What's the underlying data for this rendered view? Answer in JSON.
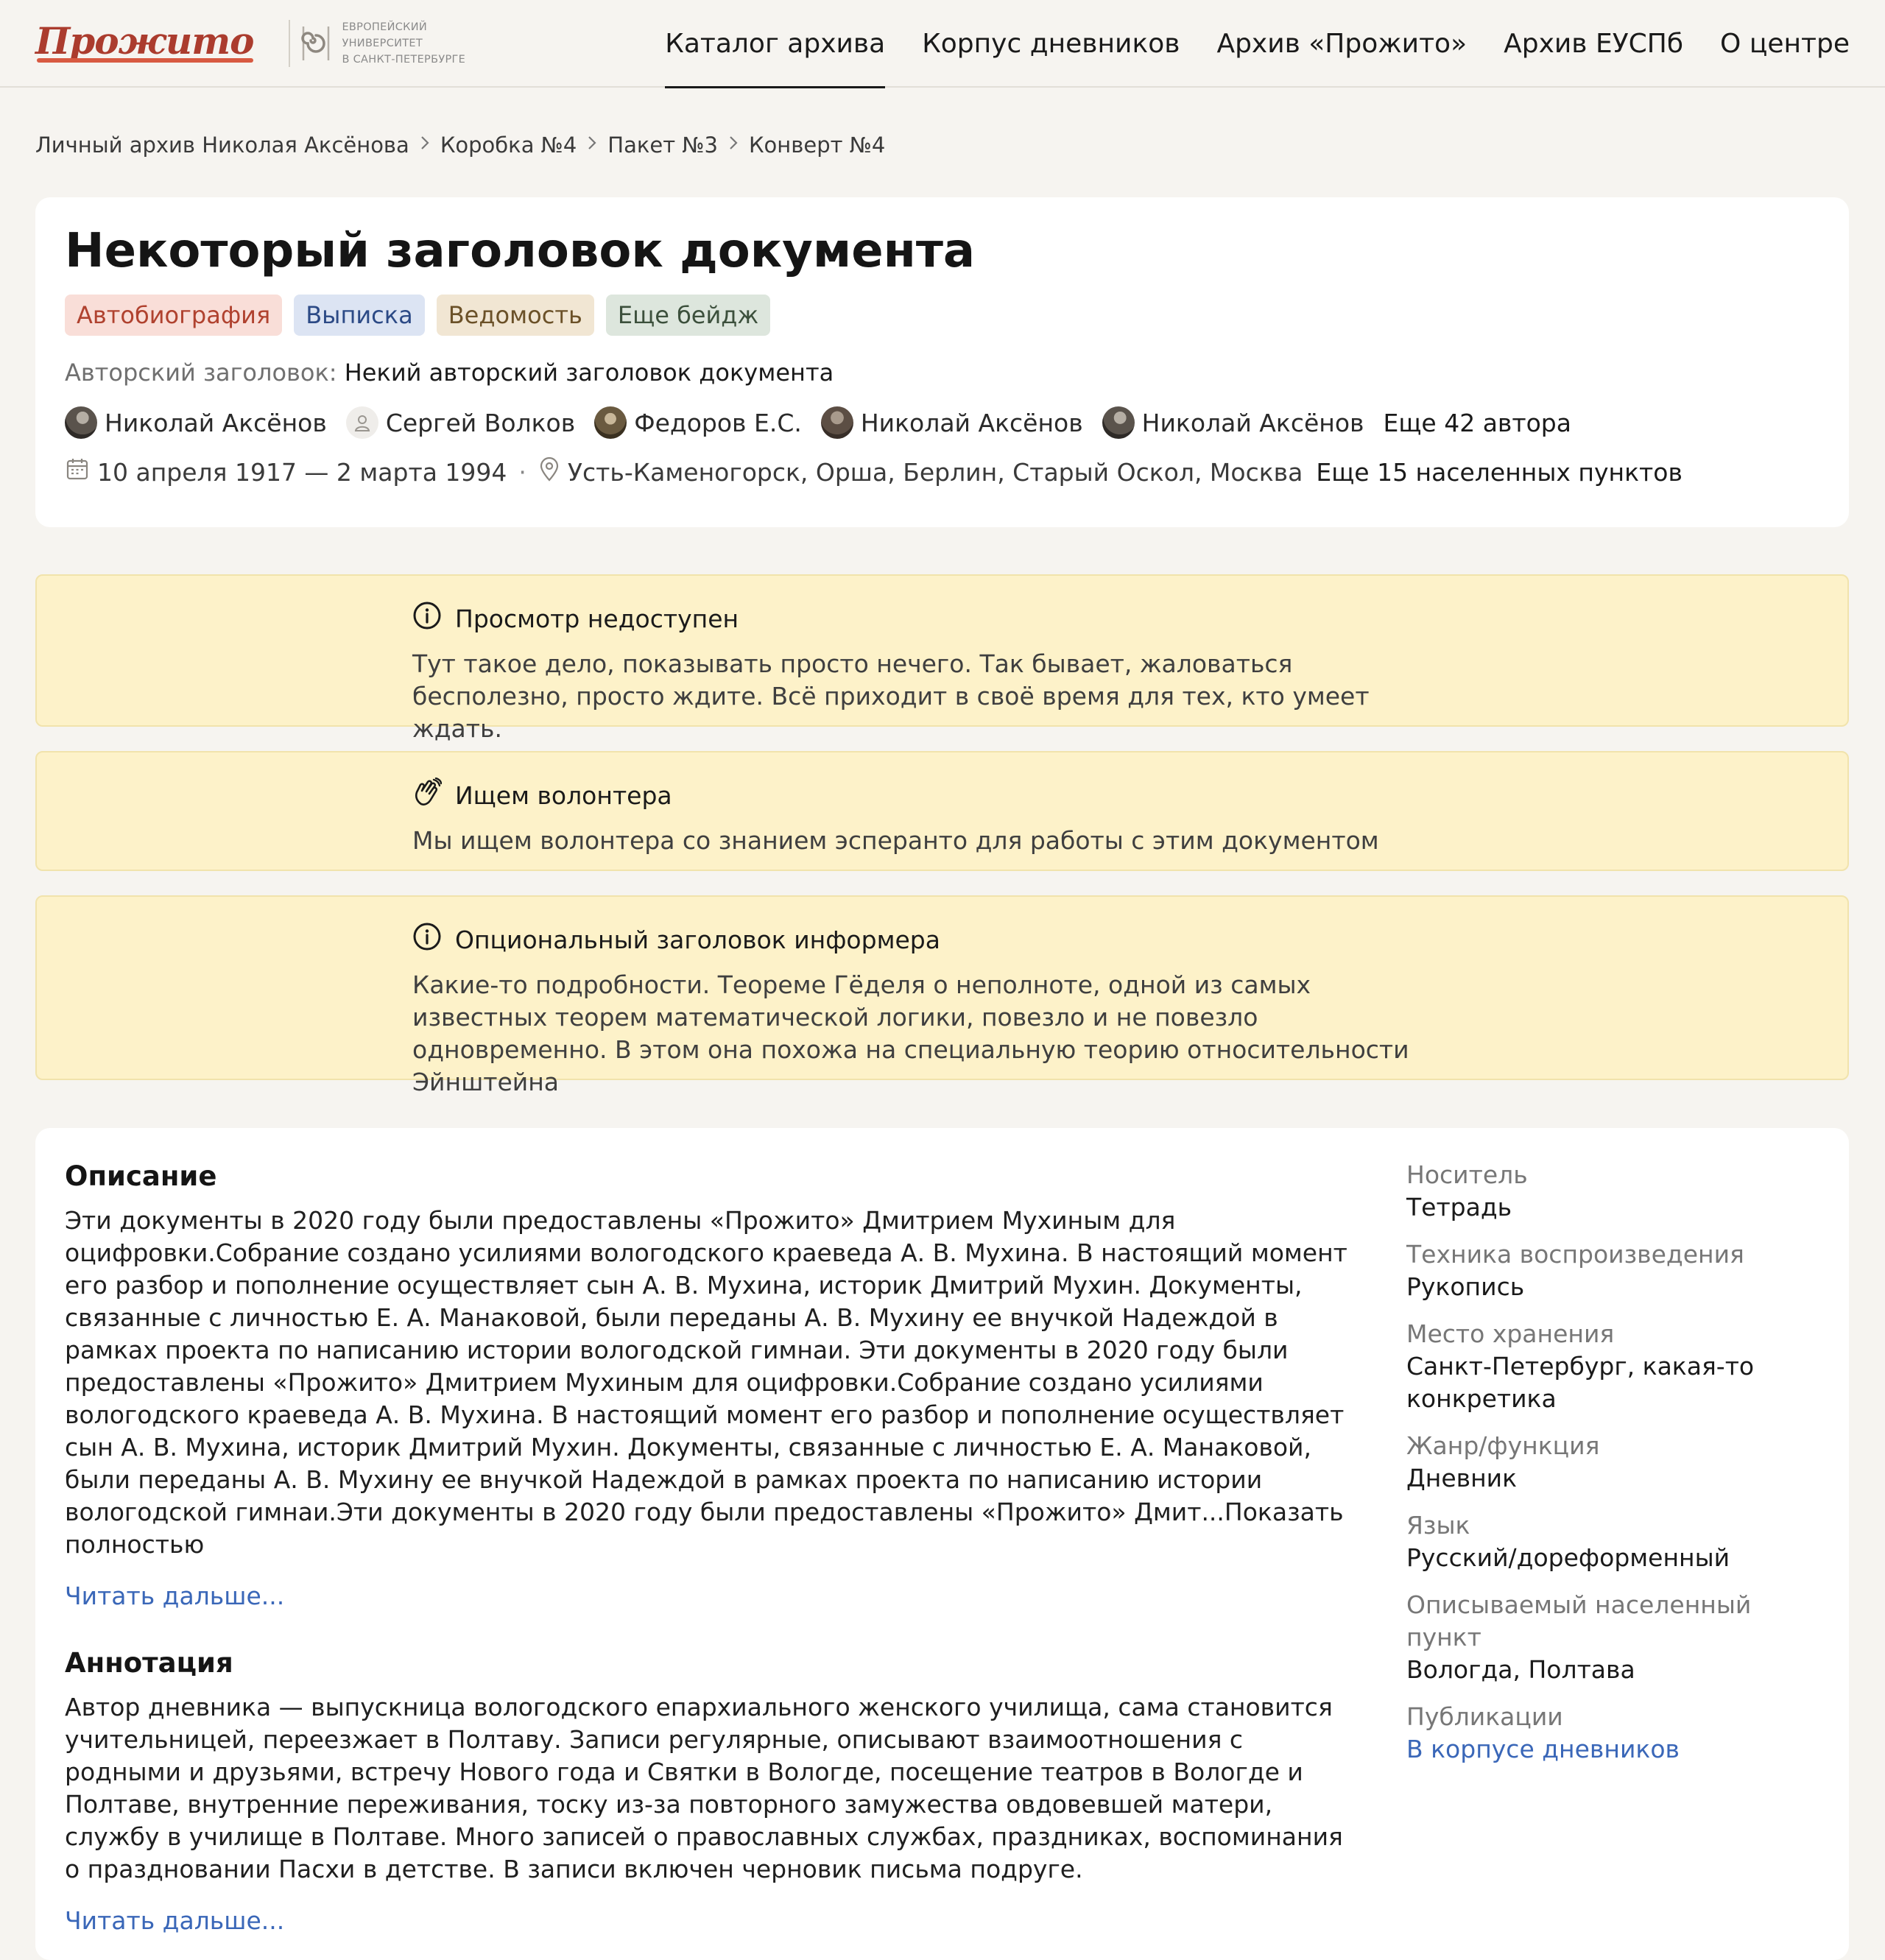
{
  "header": {
    "logo": "Прожито",
    "university": [
      "Европейский",
      "университет",
      "в Санкт-Петербурге"
    ],
    "nav": [
      {
        "label": "Каталог архива",
        "active": true
      },
      {
        "label": "Корпус дневников",
        "active": false
      },
      {
        "label": "Архив «Прожито»",
        "active": false
      },
      {
        "label": "Архив ЕУСПб",
        "active": false
      },
      {
        "label": "О центре",
        "active": false
      }
    ]
  },
  "breadcrumb": [
    "Личный архив Николая Аксёнова",
    "Коробка №4",
    "Пакет №3",
    "Конверт №4"
  ],
  "document": {
    "title": "Некоторый заголовок документа",
    "badges": [
      "Автобиография",
      "Выписка",
      "Ведомость",
      "Еще бейдж"
    ],
    "author_title_label": "Авторский заголовок:",
    "author_title": "Некий авторский заголовок документа",
    "authors": [
      "Николай Аксёнов",
      "Сергей Волков",
      "Федоров Е.С.",
      "Николай Аксёнов",
      "Николай Аксёнов"
    ],
    "more_authors": "Еще 42 автора",
    "dates": "10 апреля 1917 — 2 марта 1994",
    "separator": "·",
    "places": "Усть-Каменогорск, Орша, Берлин, Старый Оскол, Москва",
    "more_places": "Еще 15 населенных пунктов"
  },
  "informers": [
    {
      "icon": "info-icon",
      "title": "Просмотр недоступен",
      "text": "Тут такое дело, показывать просто нечего. Так бывает, жаловаться бесполезно, просто ждите. Всё приходит в своё время для тех, кто умеет ждать."
    },
    {
      "icon": "hand-wave-icon",
      "title": "Ищем волонтера",
      "text": "Мы ищем волонтера со знанием эсперанто для работы с этим документом"
    },
    {
      "icon": "info-icon",
      "title": "Опциональный заголовок информера",
      "text": "Какие-то подробности. Теореме Гёделя о неполноте, одной из самых известных теорем математической логики, повезло и не повезло одновременно. В этом она похожа на специальную теорию относительности Эйнштейна"
    }
  ],
  "description": {
    "title": "Описание",
    "text": "Эти документы в 2020 году были предоставлены «Прожито» Дмитрием Мухиным для оцифровки.Собрание создано усилиями вологодского краеведа А. В. Мухина. В настоящий момент его разбор и пополнение осуществляет сын А. В. Мухина, историк Дмитрий Мухин. Документы, связанные с личностью Е. А. Манаковой, были переданы А. В. Мухину ее внучкой Надеждой в рамках проекта по написанию истории вологодской гимнаи. Эти документы в 2020 году были предоставлены «Прожито» Дмитрием Мухиным для оцифровки.Собрание создано усилиями вологодского краеведа А. В. Мухина. В настоящий момент его разбор и пополнение осуществляет сын А. В. Мухина, историк Дмитрий Мухин. Документы, связанные с личностью Е. А. Манаковой, были переданы А. В. Мухину ее внучкой Надеждой в рамках проекта по написанию истории вологодской гимнаи.Эти документы в 2020 году были предоставлены «Прожито» Дмит...Показать полностью",
    "read_more": "Читать дальше..."
  },
  "annotation": {
    "title": "Аннотация",
    "text": "Автор дневника — выпускница вологодского епархиального женского училища, сама становится учительницей, переезжает в Полтаву. Записи регулярные, описывают взаимоотношения с родными и друзьями, встречу Нового года и Святки в Вологде, посещение театров в Вологде и Полтаве, внутренние переживания, тоску из-за повторного замужества овдовевшей матери, службу в училище в Полтаве. Много записей о православных службах, праздниках, воспоминания о праздновании Пасхи в детстве. В записи включен черновик письма подруге.",
    "read_more": "Читать дальше..."
  },
  "properties": [
    {
      "label": "Носитель",
      "value": "Тетрадь"
    },
    {
      "label": "Техника воспроизведения",
      "value": "Рукопись"
    },
    {
      "label": "Место хранения",
      "value": "Санкт-Петербург, какая-то конкретика"
    },
    {
      "label": "Жанр/функция",
      "value": "Дневник"
    },
    {
      "label": "Язык",
      "value": "Русский/дореформенный"
    },
    {
      "label": "Описываемый населенный пункт",
      "value": "Вологда, Полтава"
    },
    {
      "label": "Публикации",
      "value": "В корпусе дневников"
    }
  ],
  "colors": {
    "accent_logo": "#ab3c2e",
    "link": "#3a67b8",
    "informer_bg": "#fdf2c9",
    "page_bg": "#f6f4f0"
  }
}
